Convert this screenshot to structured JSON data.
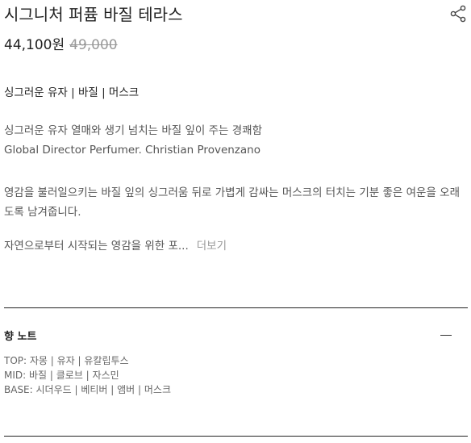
{
  "product": {
    "title": "시그니처 퍼퓸 바질 테라스",
    "price": "44,100원",
    "original_price": "49,000",
    "notes_summary": "싱그러운 유자 | 바질 | 머스크"
  },
  "description": {
    "line1": "싱그러운 유자 열매와 생기 넘치는 바질 잎이 주는 경쾌함",
    "line2": "Global Director Perfumer. Christian Provenzano",
    "line3": "영감을 불러일으키는 바질 잎의 싱그러움 뒤로 가볍게 감싸는 머스크의 터치는 기분 좋은 여운을 오래도록 남겨줍니다.",
    "line4": "자연으로부터 시작되는 영감을 위한 포...",
    "more_label": "더보기"
  },
  "scent_notes": {
    "title": "향 노트",
    "items": [
      "TOP: 자몽 | 유자 | 유칼립투스",
      "MID: 바질 | 클로브 | 자스민",
      "BASE: 시더우드 | 베티버 | 앰버 | 머스크"
    ]
  },
  "icons": {
    "share": "share-icon",
    "collapse": "minus-icon"
  }
}
